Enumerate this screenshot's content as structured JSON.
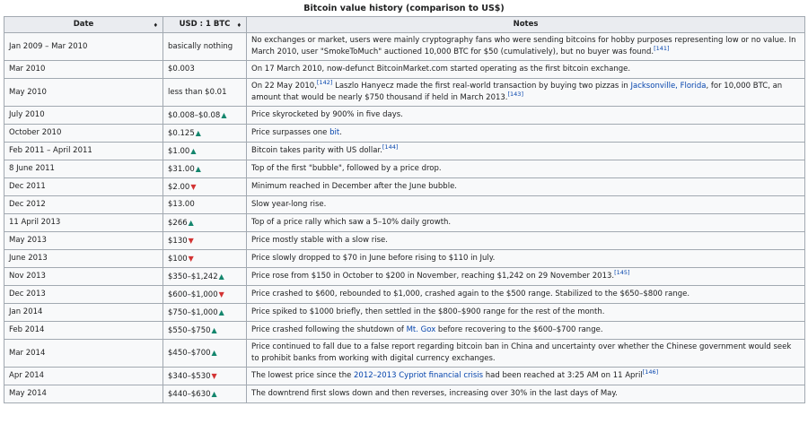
{
  "caption": "Bitcoin value history (comparison to US$)",
  "headers": {
    "date": "Date",
    "usd": "USD : 1 BTC",
    "notes": "Notes",
    "sort_icon": "sort-icon"
  },
  "colors": {
    "up": "#14866d",
    "down": "#d33333",
    "link": "#0645ad",
    "header_bg": "#eaecf0",
    "cell_bg": "#f8f9fa",
    "border": "#a2a9b1"
  },
  "rows": [
    {
      "date": "Jan 2009 – Mar 2010",
      "price": "basically nothing",
      "trend": "",
      "tall": true,
      "notes": [
        {
          "t": "No exchanges or market, users were mainly cryptography fans who were sending bitcoins for hobby purposes representing low or no value. In March 2010, user \"SmokeToMuch\" auctioned 10,000 BTC for $50 (cumulatively), but no buyer was found."
        },
        {
          "t": "[141]",
          "sup": true
        }
      ]
    },
    {
      "date": "Mar 2010",
      "price": "$0.003",
      "trend": "",
      "notes": [
        {
          "t": "On 17 March 2010, now-defunct BitcoinMarket.com started operating as the first bitcoin exchange."
        }
      ]
    },
    {
      "date": "May 2010",
      "price": "less than $0.01",
      "trend": "",
      "tall": true,
      "notes": [
        {
          "t": "On 22 May 2010,"
        },
        {
          "t": "[142]",
          "sup": true
        },
        {
          "t": " Laszlo Hanyecz made the first real-world transaction by buying two pizzas in "
        },
        {
          "t": "Jacksonville, Florida",
          "link": true
        },
        {
          "t": ", for 10,000 BTC, an amount that would be nearly $750 thousand if held in March 2013."
        },
        {
          "t": "[143]",
          "sup": true
        }
      ]
    },
    {
      "date": "July 2010",
      "price": "$0.008–$0.08",
      "trend": "up",
      "notes": [
        {
          "t": "Price skyrocketed by 900% in five days."
        }
      ]
    },
    {
      "date": "October 2010",
      "price": "$0.125",
      "trend": "up",
      "notes": [
        {
          "t": "Price surpasses one "
        },
        {
          "t": "bit",
          "link": true
        },
        {
          "t": "."
        }
      ]
    },
    {
      "date": "Feb 2011 – April 2011",
      "price": "$1.00",
      "trend": "up",
      "notes": [
        {
          "t": "Bitcoin takes parity with US dollar."
        },
        {
          "t": "[144]",
          "sup": true
        }
      ]
    },
    {
      "date": "8 June 2011",
      "price": "$31.00",
      "trend": "up",
      "notes": [
        {
          "t": "Top of the first \"bubble\", followed by a price drop."
        }
      ]
    },
    {
      "date": "Dec 2011",
      "price": "$2.00",
      "trend": "down",
      "notes": [
        {
          "t": "Minimum reached in December after the June bubble."
        }
      ]
    },
    {
      "date": "Dec 2012",
      "price": "$13.00",
      "trend": "",
      "notes": [
        {
          "t": "Slow year-long rise."
        }
      ]
    },
    {
      "date": "11 April 2013",
      "price": "$266",
      "trend": "up",
      "notes": [
        {
          "t": "Top of a price rally which saw a 5–10% daily growth."
        }
      ]
    },
    {
      "date": "May 2013",
      "price": "$130",
      "trend": "down",
      "notes": [
        {
          "t": "Price mostly stable with a slow rise."
        }
      ]
    },
    {
      "date": "June 2013",
      "price": "$100",
      "trend": "down",
      "notes": [
        {
          "t": "Price slowly dropped to $70 in June before rising to $110 in July."
        }
      ]
    },
    {
      "date": "Nov 2013",
      "price": "$350–$1,242",
      "trend": "up",
      "notes": [
        {
          "t": "Price rose from $150 in October to $200 in November, reaching $1,242 on 29 November 2013."
        },
        {
          "t": "[145]",
          "sup": true
        }
      ]
    },
    {
      "date": "Dec 2013",
      "price": "$600–$1,000",
      "trend": "down",
      "notes": [
        {
          "t": "Price crashed to $600, rebounded to $1,000, crashed again to the $500 range. Stabilized to the $650–$800 range."
        }
      ]
    },
    {
      "date": "Jan 2014",
      "price": "$750–$1,000",
      "trend": "up",
      "notes": [
        {
          "t": "Price spiked to $1000 briefly, then settled in the $800–$900 range for the rest of the month."
        }
      ]
    },
    {
      "date": "Feb 2014",
      "price": "$550–$750",
      "trend": "up",
      "notes": [
        {
          "t": "Price crashed following the shutdown of "
        },
        {
          "t": "Mt. Gox",
          "link": true
        },
        {
          "t": " before recovering to the $600–$700 range."
        }
      ]
    },
    {
      "date": "Mar 2014",
      "price": "$450–$700",
      "trend": "up",
      "tall": true,
      "notes": [
        {
          "t": "Price continued to fall due to a false report regarding bitcoin ban in China and uncertainty over whether the Chinese government would seek to prohibit banks from working with digital currency exchanges."
        }
      ]
    },
    {
      "date": "Apr 2014",
      "price": "$340–$530",
      "trend": "down",
      "notes": [
        {
          "t": "The lowest price since the "
        },
        {
          "t": "2012–2013 Cypriot financial crisis",
          "link": true
        },
        {
          "t": " had been reached at 3:25 AM on 11 April"
        },
        {
          "t": "[146]",
          "sup": true
        }
      ]
    },
    {
      "date": "May 2014",
      "price": "$440–$630",
      "trend": "up",
      "notes": [
        {
          "t": "The downtrend first slows down and then reverses, increasing over 30% in the last days of May."
        }
      ]
    }
  ]
}
